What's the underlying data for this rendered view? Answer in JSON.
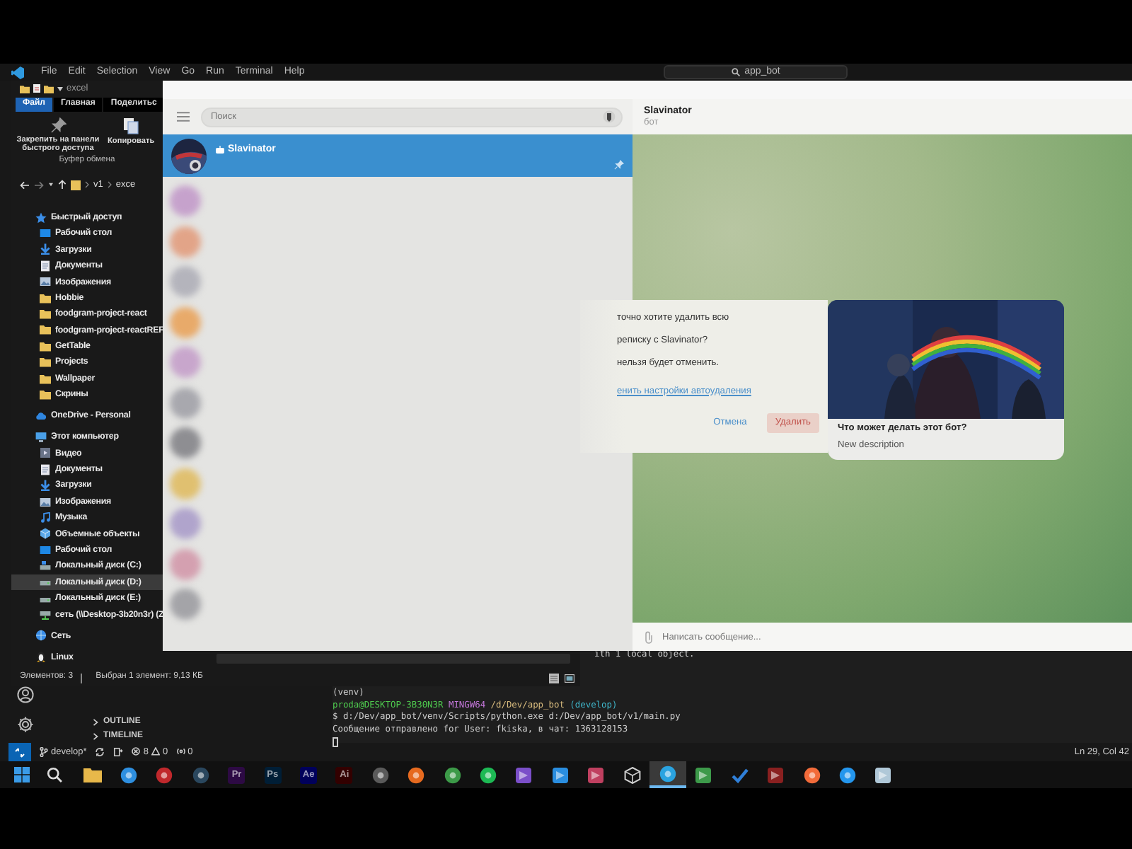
{
  "vscode": {
    "menu": [
      "File",
      "Edit",
      "Selection",
      "View",
      "Go",
      "Run",
      "Terminal",
      "Help"
    ],
    "search": "app_bot",
    "sidebar_sections": [
      {
        "label": "OUTLINE",
        "expanded": false
      },
      {
        "label": "TIMELINE",
        "expanded": false
      }
    ],
    "terminal": {
      "scrollback": "ith 1 local object.",
      "lines": [
        {
          "segments": [
            {
              "text": "(venv)",
              "kind": "plain"
            }
          ]
        },
        {
          "segments": [
            {
              "text": "proda@DESKTOP-3B30N3R ",
              "kind": "user"
            },
            {
              "text": "MINGW64 ",
              "kind": "system"
            },
            {
              "text": "/d/Dev/app_bot ",
              "kind": "path"
            },
            {
              "text": "(develop)",
              "kind": "branch"
            }
          ]
        },
        {
          "segments": [
            {
              "text": "$ d:/Dev/app_bot/venv/Scripts/python.exe d:/Dev/app_bot/v1/main.py",
              "kind": "plain"
            }
          ]
        },
        {
          "segments": [
            {
              "text": "Сообщение отправлено for User: fkiska, в чат: 1363128153",
              "kind": "plain"
            }
          ]
        }
      ]
    },
    "status_bar": {
      "branch": "develop*",
      "errors": "8",
      "warnings": "0",
      "ports": "0",
      "position": "Ln 29, Col 42"
    }
  },
  "explorer": {
    "title": "excel",
    "ribbon_tabs": [
      {
        "label": "Файл",
        "selected": true
      },
      {
        "label": "Главная",
        "selected": false
      },
      {
        "label": "Поделитьс",
        "selected": false
      }
    ],
    "ribbon_buttons": [
      {
        "label": "Закрепить на панели быстрого доступа",
        "kind": "pin"
      },
      {
        "label": "Копировать",
        "kind": "copy"
      }
    ],
    "ribbon_group": "Буфер обмена",
    "breadcrumb": [
      "v1",
      "exce"
    ],
    "tree": [
      {
        "label": "Быстрый доступ",
        "kind": "star",
        "selected": false,
        "children": [
          {
            "label": "Рабочий стол",
            "kind": "desktop",
            "selected": false
          },
          {
            "label": "Загрузки",
            "kind": "download",
            "selected": false
          },
          {
            "label": "Документы",
            "kind": "document",
            "selected": false
          },
          {
            "label": "Изображения",
            "kind": "images",
            "selected": false
          },
          {
            "label": "Hobbie",
            "kind": "folder",
            "selected": false
          },
          {
            "label": "foodgram-project-react",
            "kind": "folder",
            "selected": false
          },
          {
            "label": "foodgram-project-reactREF",
            "kind": "folder",
            "selected": false
          },
          {
            "label": "GetTable",
            "kind": "folder",
            "selected": false
          },
          {
            "label": "Projects",
            "kind": "folder",
            "selected": false
          },
          {
            "label": "Wallpaper",
            "kind": "folder",
            "selected": false
          },
          {
            "label": "Скрины",
            "kind": "folder",
            "selected": false
          }
        ]
      },
      {
        "label": "OneDrive - Personal",
        "kind": "cloud",
        "selected": false
      },
      {
        "label": "Этот компьютер",
        "kind": "computer",
        "selected": false,
        "children": [
          {
            "label": "Видео",
            "kind": "video",
            "selected": false
          },
          {
            "label": "Документы",
            "kind": "document",
            "selected": false
          },
          {
            "label": "Загрузки",
            "kind": "download",
            "selected": false
          },
          {
            "label": "Изображения",
            "kind": "images",
            "selected": false
          },
          {
            "label": "Музыка",
            "kind": "music",
            "selected": false
          },
          {
            "label": "Объемные объекты",
            "kind": "cube",
            "selected": false
          },
          {
            "label": "Рабочий стол",
            "kind": "desktop",
            "selected": false
          },
          {
            "label": "Локальный диск (C:)",
            "kind": "drive-os",
            "selected": false
          },
          {
            "label": "Локальный диск (D:)",
            "kind": "drive",
            "selected": true
          },
          {
            "label": "Локальный диск (E:)",
            "kind": "drive",
            "selected": false
          },
          {
            "label": "сеть (\\\\Desktop-3b20n3r) (Z",
            "kind": "netdrive",
            "selected": false
          }
        ]
      },
      {
        "label": "Сеть",
        "kind": "network",
        "selected": false
      },
      {
        "label": "Linux",
        "kind": "linux",
        "selected": false
      }
    ],
    "status": [
      "Элементов: 3",
      "Выбран 1 элемент: 9,13 КБ"
    ]
  },
  "telegram": {
    "search": {
      "placeholder": "Поиск"
    },
    "chats": [
      {
        "name": "Slavinator",
        "selected": true,
        "pinned": true
      }
    ],
    "blurred_avatars": [
      {
        "color": "#c6a2cc"
      },
      {
        "color": "#e2a488"
      },
      {
        "color": "#b4b4bc"
      },
      {
        "color": "#e8aa6a"
      },
      {
        "color": "#c8a6cc"
      },
      {
        "color": "#a8a8ae"
      },
      {
        "color": "#8e8e92"
      },
      {
        "color": "#e0c070"
      },
      {
        "color": "#b0a4cc"
      },
      {
        "color": "#d4a0b0"
      },
      {
        "color": "#a4a4a8"
      }
    ],
    "header": {
      "title": "Slavinator",
      "subtitle": "бот"
    },
    "dialog": {
      "lines": [
        "точно хотите удалить всю",
        "реписку с Slavinator?",
        "нельзя будет отменить."
      ],
      "link": "енить настройки автоудаления",
      "buttons": [
        {
          "label": "Отмена",
          "kind": "cancel"
        },
        {
          "label": "Удалить",
          "kind": "danger"
        }
      ]
    },
    "bot_card": {
      "title": "Что может делать этот бот?",
      "description": "New description"
    },
    "composer": {
      "placeholder": "Написать сообщение..."
    }
  },
  "taskbar": {
    "apps": [
      {
        "kind": "folder",
        "color": "#e8b84a",
        "selected": false
      },
      {
        "kind": "circle",
        "color": "#2e8fe0",
        "selected": false
      },
      {
        "kind": "circle",
        "color": "#c0282c",
        "selected": false
      },
      {
        "kind": "circle",
        "color": "#2a475e",
        "selected": false
      },
      {
        "kind": "label",
        "label": "Pr",
        "color": "#2d0a44",
        "selected": false
      },
      {
        "kind": "label",
        "label": "Ps",
        "color": "#001e36",
        "selected": false
      },
      {
        "kind": "label",
        "label": "Ae",
        "color": "#00005b",
        "selected": false
      },
      {
        "kind": "label",
        "label": "Ai",
        "color": "#330000",
        "selected": false
      },
      {
        "kind": "circle",
        "color": "#5a5a5a",
        "selected": false
      },
      {
        "kind": "circle",
        "color": "#e66a1f",
        "selected": false
      },
      {
        "kind": "circle",
        "color": "#3c9a48",
        "selected": false
      },
      {
        "kind": "circle",
        "color": "#1db954",
        "selected": false
      },
      {
        "kind": "square",
        "color": "#7b4fc9",
        "selected": false
      },
      {
        "kind": "square",
        "color": "#2a8ee0",
        "selected": false
      },
      {
        "kind": "square",
        "color": "#c04060",
        "selected": false
      },
      {
        "kind": "cube",
        "color": "#d0d0d0",
        "selected": false
      },
      {
        "kind": "circle",
        "color": "#2aa3e0",
        "selected": true
      },
      {
        "kind": "square",
        "color": "#3d9a4a",
        "selected": false
      },
      {
        "kind": "check",
        "color": "#2f7fd8",
        "selected": false
      },
      {
        "kind": "square",
        "color": "#8a2020",
        "selected": false
      },
      {
        "kind": "circle",
        "color": "#f26b3a",
        "selected": false
      },
      {
        "kind": "circle",
        "color": "#2496ed",
        "selected": false
      },
      {
        "kind": "square",
        "color": "#b0c8d8",
        "selected": false
      }
    ]
  }
}
